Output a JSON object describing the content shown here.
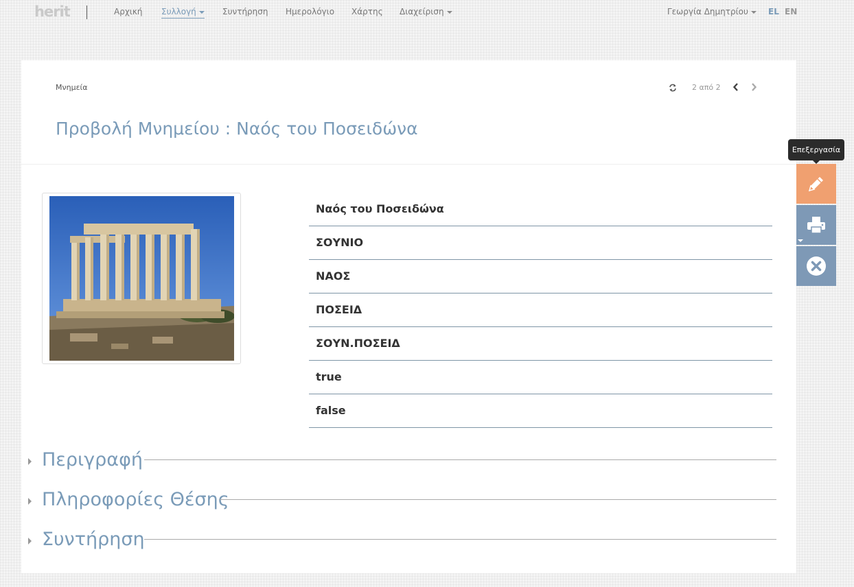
{
  "brand": {
    "logo_text": "herit"
  },
  "nav": {
    "items": [
      {
        "label": "Αρχική"
      },
      {
        "label": "Συλλογή"
      },
      {
        "label": "Συντήρηση"
      },
      {
        "label": "Ημερολόγιο"
      },
      {
        "label": "Χάρτης"
      },
      {
        "label": "Διαχείριση"
      }
    ],
    "user": "Γεωργία Δημητρίου",
    "languages": [
      "EL",
      "EN"
    ]
  },
  "header": {
    "breadcrumb": "Μνημεία",
    "counter": "2 από 2",
    "title": "Προβολή Μνημείου : Ναός του Ποσειδώνα"
  },
  "fields": [
    "Ναός του Ποσειδώνα",
    "ΣΟΥΝΙΟ",
    "ΝΑΟΣ",
    "ΠΟΣΕΙΔ",
    "ΣΟΥΝ.ΠΟΣΕΙΔ",
    "true",
    "false"
  ],
  "sections": [
    "Περιγραφή",
    "Πληροφορίες Θέσης",
    "Συντήρηση"
  ],
  "actions": {
    "edit_tooltip": "Επεξεργασία",
    "icons": [
      "pencil-icon",
      "printer-icon",
      "close-circle-icon"
    ]
  },
  "colors": {
    "accent": "#7a9bb8",
    "edit": "#f0a070",
    "secondary_action": "#7e99b6"
  }
}
